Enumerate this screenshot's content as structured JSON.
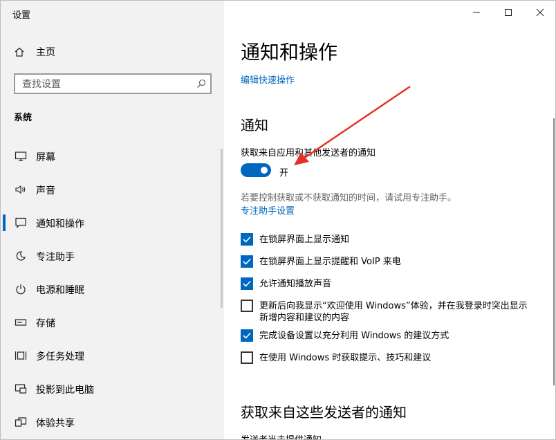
{
  "window": {
    "title": "设置",
    "controls": {
      "minimize": "—",
      "maximize": "☐",
      "close": "✕"
    }
  },
  "sidebar": {
    "home_label": "主页",
    "search_placeholder": "查找设置",
    "section": "系统",
    "items": [
      {
        "label": "屏幕",
        "icon": "monitor-icon"
      },
      {
        "label": "声音",
        "icon": "speaker-icon"
      },
      {
        "label": "通知和操作",
        "icon": "notification-icon",
        "active": true
      },
      {
        "label": "专注助手",
        "icon": "moon-icon"
      },
      {
        "label": "电源和睡眠",
        "icon": "power-icon"
      },
      {
        "label": "存储",
        "icon": "storage-icon"
      },
      {
        "label": "多任务处理",
        "icon": "multitask-icon"
      },
      {
        "label": "投影到此电脑",
        "icon": "project-icon"
      },
      {
        "label": "体验共享",
        "icon": "share-icon"
      }
    ]
  },
  "main": {
    "title": "通知和操作",
    "quick_actions_link": "编辑快速操作",
    "notifications_heading": "通知",
    "notifications_toggle_label": "获取来自应用和其他发送者的通知",
    "toggle_state_text": "开",
    "toggle_on": true,
    "helper_text": "若要控制获取或不获取通知的时间，请试用专注助手。",
    "focus_assist_link": "专注助手设置",
    "checkboxes": [
      {
        "label": "在锁屏界面上显示通知",
        "checked": true
      },
      {
        "label": "在锁屏界面上显示提醒和 VoIP 来电",
        "checked": true
      },
      {
        "label": "允许通知播放声音",
        "checked": true
      },
      {
        "label": "更新后向我显示“欢迎使用 Windows”体验，并在我登录时突出显示新增内容和建议的内容",
        "checked": false
      },
      {
        "label": "完成设备设置以充分利用 Windows 的建议方式",
        "checked": true
      },
      {
        "label": "在使用 Windows 时获取提示、技巧和建议",
        "checked": false
      }
    ],
    "senders_heading": "获取来自这些发送者的通知",
    "senders_subtext": "发送者当未提供通知"
  },
  "colors": {
    "accent": "#0067c0",
    "annotation": "#e8302a"
  }
}
